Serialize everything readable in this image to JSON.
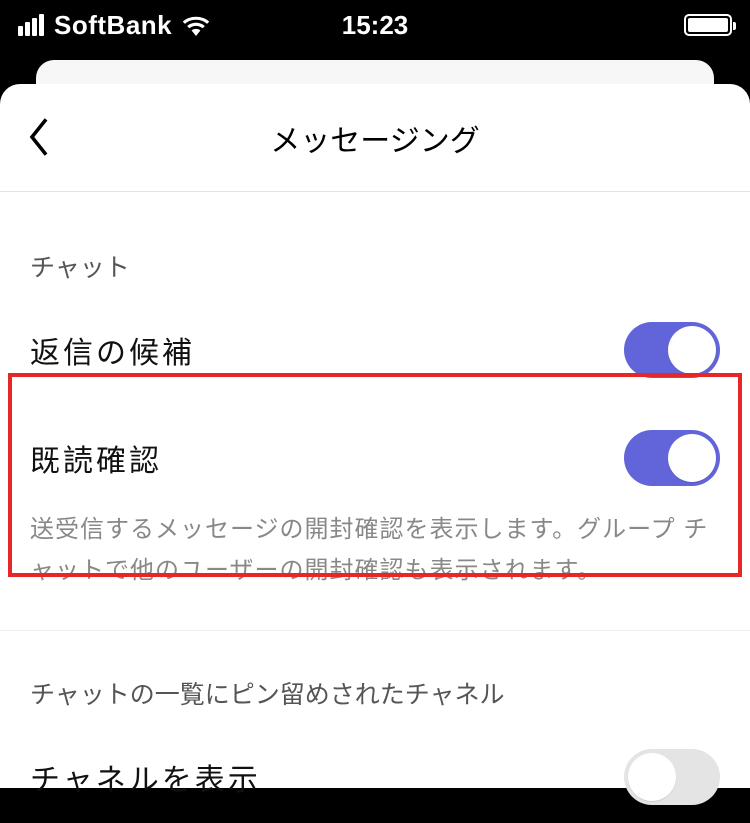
{
  "status": {
    "carrier": "SoftBank",
    "time": "15:23"
  },
  "nav": {
    "title": "メッセージング"
  },
  "section1": {
    "header": "チャット",
    "reply_suggestions_label": "返信の候補",
    "read_receipts_label": "既読確認",
    "read_receipts_desc": "送受信するメッセージの開封確認を表示します。グループ チャットで他のユーザーの開封確認も表示されます。"
  },
  "section2": {
    "header": "チャットの一覧にピン留めされたチャネル",
    "show_channels_label": "チャネルを表示"
  },
  "toggles": {
    "reply_suggestions": true,
    "read_receipts": true,
    "show_channels": false
  }
}
